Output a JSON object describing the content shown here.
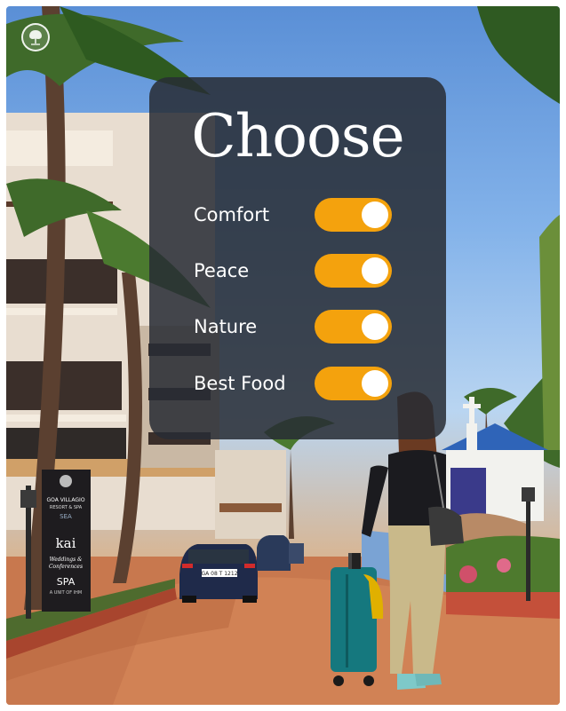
{
  "panel": {
    "title": "Choose",
    "options": [
      {
        "label": "Comfort",
        "enabled": true
      },
      {
        "label": "Peace",
        "enabled": true
      },
      {
        "label": "Nature",
        "enabled": true
      },
      {
        "label": "Best Food",
        "enabled": true
      }
    ]
  },
  "signboard": {
    "brand": "GOA VILLAGIO",
    "subtitle": "RESORT & SPA",
    "tag": "SEA",
    "kai": "kai",
    "weddings_line1": "Weddings &",
    "weddings_line2": "Conferences",
    "spa": "SPA",
    "footer": "A UNIT OF IHM"
  },
  "car": {
    "plate": "GA 08 T 1212"
  },
  "colors": {
    "panel_bg": "#282c34",
    "toggle_on": "#f4a20d",
    "knob": "#ffffff",
    "text": "#ffffff"
  },
  "icons": {
    "logo": "tree-logo-icon"
  }
}
